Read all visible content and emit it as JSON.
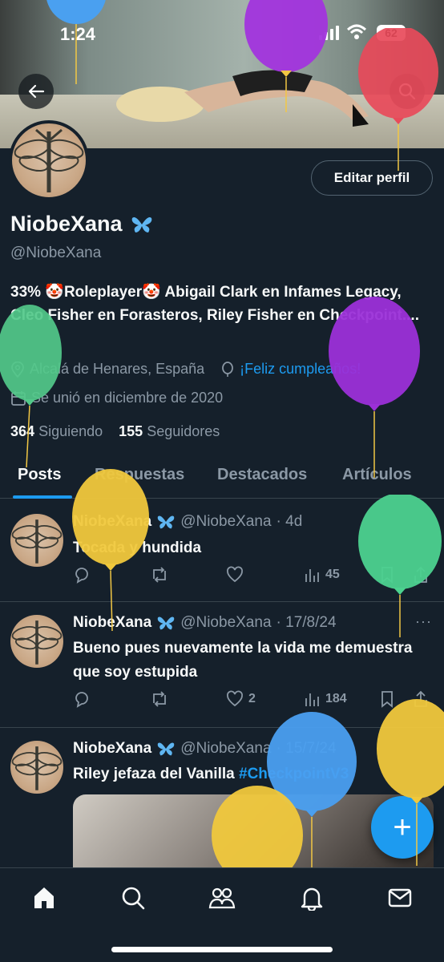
{
  "status_bar": {
    "time": "1:24",
    "battery": "62"
  },
  "profile": {
    "name": "NiobeXana",
    "handle": "@NiobeXana",
    "edit_label": "Editar perfil",
    "bio": "33% 🤡Roleplayer🤡 Abigail Clark en Infames Legacy, Cleo Fisher en Forasteros, Riley Fisher en Checkpoint....",
    "location": "Alcalá de Henares, España",
    "birthday": "¡Feliz cumpleaños!",
    "joined": "Se unió en diciembre de 2020",
    "following_count": "364",
    "following_label": "Siguiendo",
    "followers_count": "155",
    "followers_label": "Seguidores"
  },
  "tabs": [
    {
      "label": "Posts",
      "active": true
    },
    {
      "label": "Respuestas"
    },
    {
      "label": "Destacados"
    },
    {
      "label": "Artículos"
    }
  ],
  "posts": [
    {
      "name": "NiobeXana",
      "handle": "@NiobeXana",
      "time": "· 4d",
      "text": "Tocada y hundida",
      "likes": "",
      "views": "45"
    },
    {
      "name": "NiobeXana",
      "handle": "@NiobeXana",
      "time": "· 17/8/24",
      "text": "Bueno pues nuevamente la vida me demuestra que soy estupida",
      "likes": "2",
      "views": "184"
    },
    {
      "name": "NiobeXana",
      "handle": "@NiobeXana",
      "time": "· 15/7/24",
      "text": "Riley jefaza del Vanilla ",
      "hashtag": "#CheckpointV3"
    }
  ],
  "more_glyph": "···",
  "fab_label": "+",
  "icons": {
    "verified": "butterfly-icon",
    "back": "arrow-left-icon",
    "search": "search-icon",
    "location": "location-pin-icon",
    "birthday": "balloon-icon",
    "calendar": "calendar-icon",
    "reply": "reply-icon",
    "repost": "repost-icon",
    "like": "heart-icon",
    "views": "views-icon",
    "bookmark": "bookmark-icon",
    "share": "share-icon",
    "nav": [
      "home-icon",
      "search-icon",
      "communities-icon",
      "notifications-icon",
      "messages-icon"
    ]
  },
  "colors": {
    "background": "#15202b",
    "accent": "#1d9bf0",
    "muted": "#8b98a5",
    "text": "#f7f9f9",
    "butterfly": "#5fb6f2"
  }
}
